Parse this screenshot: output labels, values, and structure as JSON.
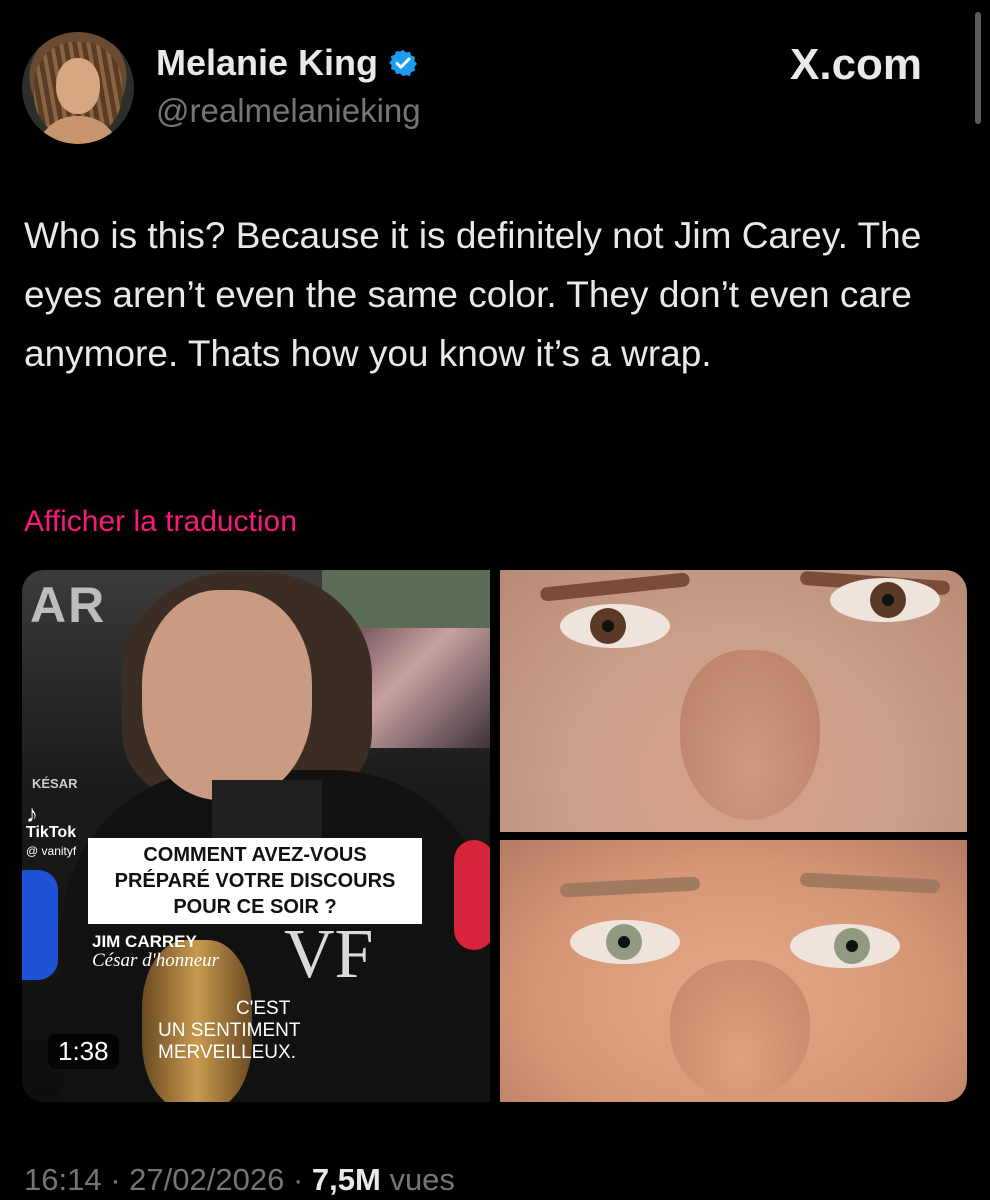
{
  "header": {
    "display_name": "Melanie King",
    "handle": "@realmelanieking",
    "brand": "X.com",
    "verified_color": "#1d9bf0"
  },
  "tweet": {
    "text": "Who is this? Because it is definitely not Jim Carey. The eyes aren’t even the same color. They don’t even care anymore. Thats how you know it’s a wrap.",
    "translate_label": "Afficher la traduction"
  },
  "media": {
    "video": {
      "background_letters": "AR",
      "bg_tag": "KÉSAR",
      "tiktok_label": "TikTok",
      "tiktok_handle": "@ vanityf",
      "caption_line1": "COMMENT AVEZ-VOUS",
      "caption_line2": "PRÉPARÉ VOTRE DISCOURS",
      "caption_line3": "POUR CE SOIR ?",
      "speaker_name": "JIM CARREY",
      "speaker_title": "César d'honneur",
      "watermark": "VF",
      "subtitle_line1": "C'EST",
      "subtitle_line2": "UN SENTIMENT MERVEILLEUX.",
      "duration": "1:38"
    },
    "photo_top": {
      "iris_color": "#5a3a26"
    },
    "photo_bottom": {
      "iris_color": "#8f9a80"
    }
  },
  "meta": {
    "time": "16:14",
    "separator": "·",
    "date": "27/02/2026",
    "views_count": "7,5M",
    "views_label": "vues"
  }
}
